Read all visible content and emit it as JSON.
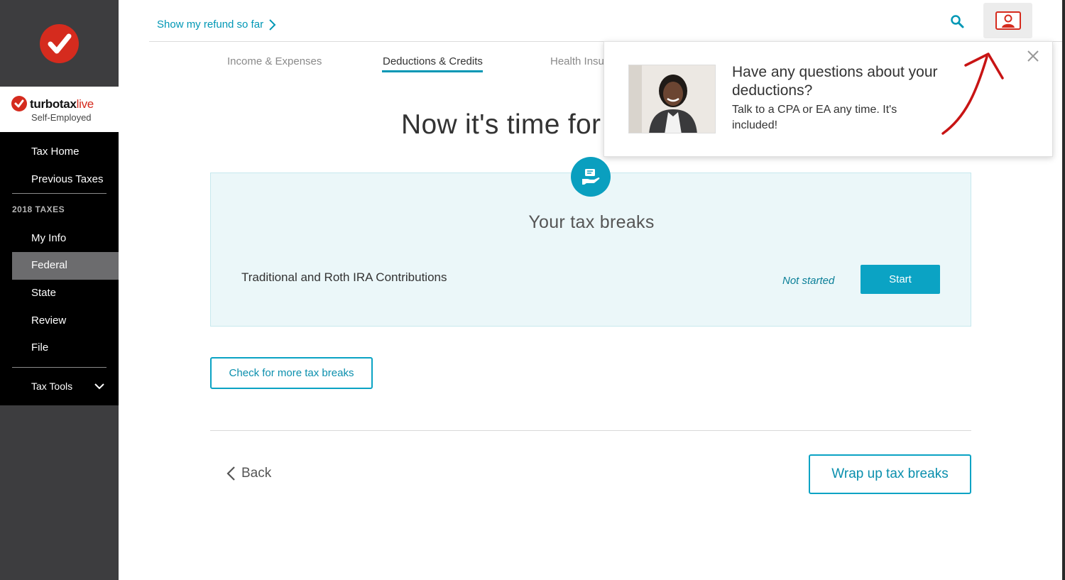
{
  "sidebar": {
    "brand": {
      "name_main": "turbotax",
      "name_accent": "live",
      "subtitle": "Self-Employed"
    },
    "nav": {
      "tax_home": "Tax Home",
      "previous_taxes": "Previous Taxes",
      "section_header": "2018 TAXES",
      "my_info": "My Info",
      "federal": "Federal",
      "state": "State",
      "review": "Review",
      "file": "File",
      "tax_tools": "Tax Tools"
    },
    "active_item": "Federal"
  },
  "header": {
    "refund_link": "Show my refund so far"
  },
  "tabs": [
    {
      "label": "Income & Expenses",
      "active": false
    },
    {
      "label": "Deductions & Credits",
      "active": true
    },
    {
      "label": "Health Insu",
      "active": false
    }
  ],
  "main": {
    "title": "Now it's time for",
    "panel": {
      "title": "Your tax breaks",
      "items": [
        {
          "name": "Traditional and Roth IRA Contributions",
          "status": "Not started",
          "action": "Start"
        }
      ]
    },
    "check_more_label": "Check for more tax breaks",
    "back_label": "Back",
    "wrap_up_label": "Wrap up tax breaks"
  },
  "popup": {
    "title": "Have any questions about your deductions?",
    "body": "Talk to a CPA or EA any time. It's included!"
  },
  "colors": {
    "accent": "#0ba3c4",
    "brand_red": "#d52b1e",
    "sidebar_dark": "#3d3d3f",
    "panel_bg": "#ebf7f9"
  },
  "icons": [
    "checkmark-logo-icon",
    "chevron-right-icon",
    "search-icon",
    "expert-video-icon",
    "tax-breaks-icon",
    "chevron-down-icon",
    "chevron-left-icon",
    "close-icon"
  ]
}
